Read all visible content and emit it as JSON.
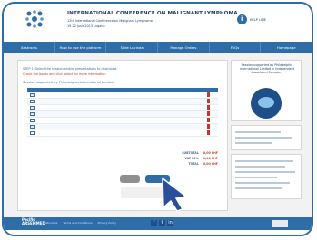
{
  "header": {
    "title": "INTERNATIONAL CONFERENCE ON MALIGNANT LYMPHOMA",
    "subtitle": "12th International Conference on Malignant Lymphoma",
    "date": "19-22 June 2013 Lugano",
    "help": "HELP LINE"
  },
  "nav": {
    "items": [
      "Abstracts",
      "How to use the platform",
      "Slide Lucinda",
      "Manage Orders",
      "FAQs",
      "Homepage"
    ]
  },
  "content": {
    "step_text": "STEP 1: Select the session and/or presentations to download.",
    "notice_text": "Check the boxes and click select for more information",
    "section_label": "Session supported by Philadelphia International Limited",
    "summary": {
      "subtotal_label": "SUBTOTAL",
      "vat_label": "VAT 22%",
      "total_label": "TOTAL",
      "subtotal": "0,00 CHF",
      "vat": "0,00 CHF",
      "total": "0,00 CHF"
    }
  },
  "sidebar": {
    "ad_text": "Session supported by Philadelphia International Limited in Independent Associated Company"
  },
  "footer": {
    "logo_line1": "Pacific",
    "logo_line2": "ARSEMMED",
    "links": [
      "About us",
      "Terms and Conditions",
      "Privacy Policy"
    ]
  },
  "colors": {
    "primary": "#2f6da8",
    "accent_red": "#c0392b",
    "dark_blue": "#1f3f73"
  }
}
